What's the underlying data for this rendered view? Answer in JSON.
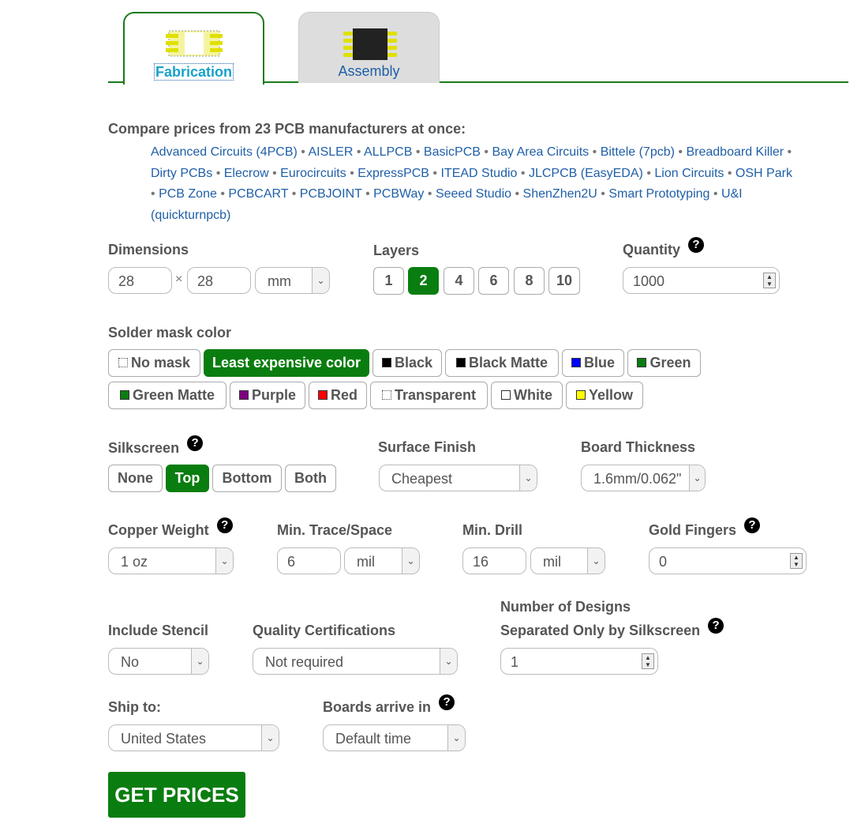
{
  "tabs": {
    "fabrication": "Fabrication",
    "assembly": "Assembly"
  },
  "compare": {
    "heading": "Compare prices from 23 PCB manufacturers at once:",
    "manufacturers": [
      "Advanced Circuits (4PCB)",
      "AISLER",
      "ALLPCB",
      "BasicPCB",
      "Bay Area Circuits",
      "Bittele (7pcb)",
      "Breadboard Killer",
      "Dirty PCBs",
      "Elecrow",
      "Eurocircuits",
      "ExpressPCB",
      "ITEAD Studio",
      "JLCPCB (EasyEDA)",
      "Lion Circuits",
      "OSH Park",
      "PCB Zone",
      "PCBCART",
      "PCBJOINT",
      "PCBWay",
      "Seeed Studio",
      "ShenZhen2U",
      "Smart Prototyping",
      "U&I (quickturnpcb)"
    ],
    "separator": "•"
  },
  "dimensions": {
    "label": "Dimensions",
    "width": "28",
    "height": "28",
    "times": "×",
    "unit": "mm"
  },
  "layers": {
    "label": "Layers",
    "options": [
      "1",
      "2",
      "4",
      "6",
      "8",
      "10"
    ],
    "selected": "2"
  },
  "quantity": {
    "label": "Quantity",
    "value": "1000"
  },
  "solder_mask": {
    "label": "Solder mask color",
    "options": [
      {
        "label": "No mask",
        "swatch": "none"
      },
      {
        "label": "Least expensive color",
        "swatch": null
      },
      {
        "label": "Black",
        "swatch": "#000000"
      },
      {
        "label": "Black Matte",
        "swatch": "#000000"
      },
      {
        "label": "Blue",
        "swatch": "#0000ff"
      },
      {
        "label": "Green",
        "swatch": "#0a7d10"
      },
      {
        "label": "Green Matte",
        "swatch": "#0a7d10"
      },
      {
        "label": "Purple",
        "swatch": "#800080"
      },
      {
        "label": "Red",
        "swatch": "#ff0000"
      },
      {
        "label": "Transparent",
        "swatch": "none"
      },
      {
        "label": "White",
        "swatch": "#ffffff"
      },
      {
        "label": "Yellow",
        "swatch": "#ffff00"
      }
    ],
    "selected": "Least expensive color"
  },
  "silkscreen": {
    "label": "Silkscreen",
    "options": [
      "None",
      "Top",
      "Bottom",
      "Both"
    ],
    "selected": "Top"
  },
  "surface_finish": {
    "label": "Surface Finish",
    "value": "Cheapest"
  },
  "board_thickness": {
    "label": "Board Thickness",
    "value": "1.6mm/0.062\""
  },
  "copper_weight": {
    "label": "Copper Weight",
    "value": "1 oz"
  },
  "min_trace": {
    "label": "Min. Trace/Space",
    "value": "6",
    "unit": "mil"
  },
  "min_drill": {
    "label": "Min. Drill",
    "value": "16",
    "unit": "mil"
  },
  "gold_fingers": {
    "label": "Gold Fingers",
    "value": "0"
  },
  "stencil": {
    "label": "Include Stencil",
    "value": "No"
  },
  "quality": {
    "label": "Quality Certifications",
    "value": "Not required"
  },
  "designs": {
    "label_line1": "Number of Designs",
    "label_line2": "Separated Only by Silkscreen",
    "value": "1"
  },
  "ship_to": {
    "label": "Ship to:",
    "value": "United States"
  },
  "arrive": {
    "label": "Boards arrive in",
    "value": "Default time"
  },
  "help_glyph": "?",
  "dropdown_glyph": "⌄",
  "get_prices": "GET PRICES",
  "colors": {
    "accent": "#0a7d10",
    "link": "#1f5fa8",
    "tab_active_text": "#17a2c9"
  }
}
